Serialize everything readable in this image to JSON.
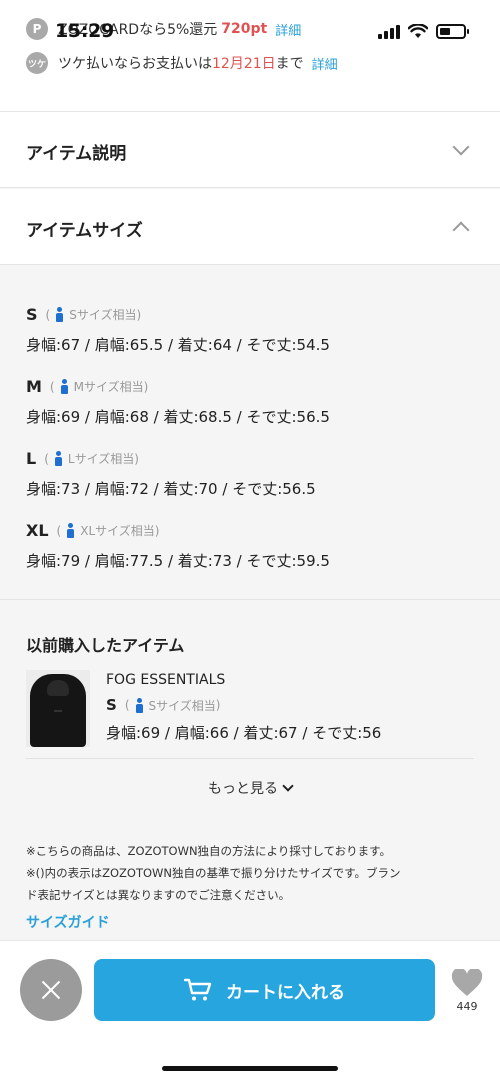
{
  "status": {
    "time": "15:29"
  },
  "promo": {
    "points_icon": "P",
    "points_text": "ZOZOCARDなら5%還元",
    "points_value": "720pt",
    "points_link": "詳細",
    "tsuke_icon": "ツケ",
    "tsuke_text_before": "ツケ払いならお支払いは",
    "tsuke_date": "12月21日",
    "tsuke_text_after": "まで",
    "tsuke_link": "詳細"
  },
  "sections": {
    "description": {
      "title": "アイテム説明",
      "expanded": false
    },
    "size": {
      "title": "アイテムサイズ",
      "expanded": true
    }
  },
  "sizes": [
    {
      "name": "S",
      "equiv": "Sサイズ相当",
      "measurements": "身幅:67 / 肩幅:65.5 / 着丈:64 / そで丈:54.5"
    },
    {
      "name": "M",
      "equiv": "Mサイズ相当",
      "measurements": "身幅:69 / 肩幅:68 / 着丈:68.5 / そで丈:56.5"
    },
    {
      "name": "L",
      "equiv": "Lサイズ相当",
      "measurements": "身幅:73 / 肩幅:72 / 着丈:70 / そで丈:56.5"
    },
    {
      "name": "XL",
      "equiv": "XLサイズ相当",
      "measurements": "身幅:79 / 肩幅:77.5 / 着丈:73 / そで丈:59.5"
    }
  ],
  "previous": {
    "title": "以前購入したアイテム",
    "brand": "FOG ESSENTIALS",
    "size_name": "S",
    "size_equiv": "Sサイズ相当",
    "measurements": "身幅:69 / 肩幅:66 / 着丈:67 / そで丈:56",
    "more_label": "もっと見る"
  },
  "notes": {
    "note1": "※こちらの商品は、ZOZOTOWN独自の方法により採寸しております。",
    "note2_line1": "※()内の表示はZOZOTOWN独自の基準で振り分けたサイズです。ブラン",
    "note2_line2": "ド表記サイズとは異なりますのでご注意ください。",
    "size_guide": "サイズガイド"
  },
  "bottom_bar": {
    "cart_label": "カートに入れる",
    "favorite_count": "449"
  },
  "colors": {
    "accent": "#26a5de",
    "link": "#2aa0d8",
    "highlight_red": "#e05252",
    "size_icon": "#1e6fd0"
  },
  "icons": [
    "points-icon",
    "tsuke-icon",
    "chevron-down-icon",
    "chevron-up-icon",
    "person-icon",
    "close-icon",
    "cart-icon",
    "heart-icon",
    "signal-icon",
    "wifi-icon",
    "battery-icon"
  ]
}
